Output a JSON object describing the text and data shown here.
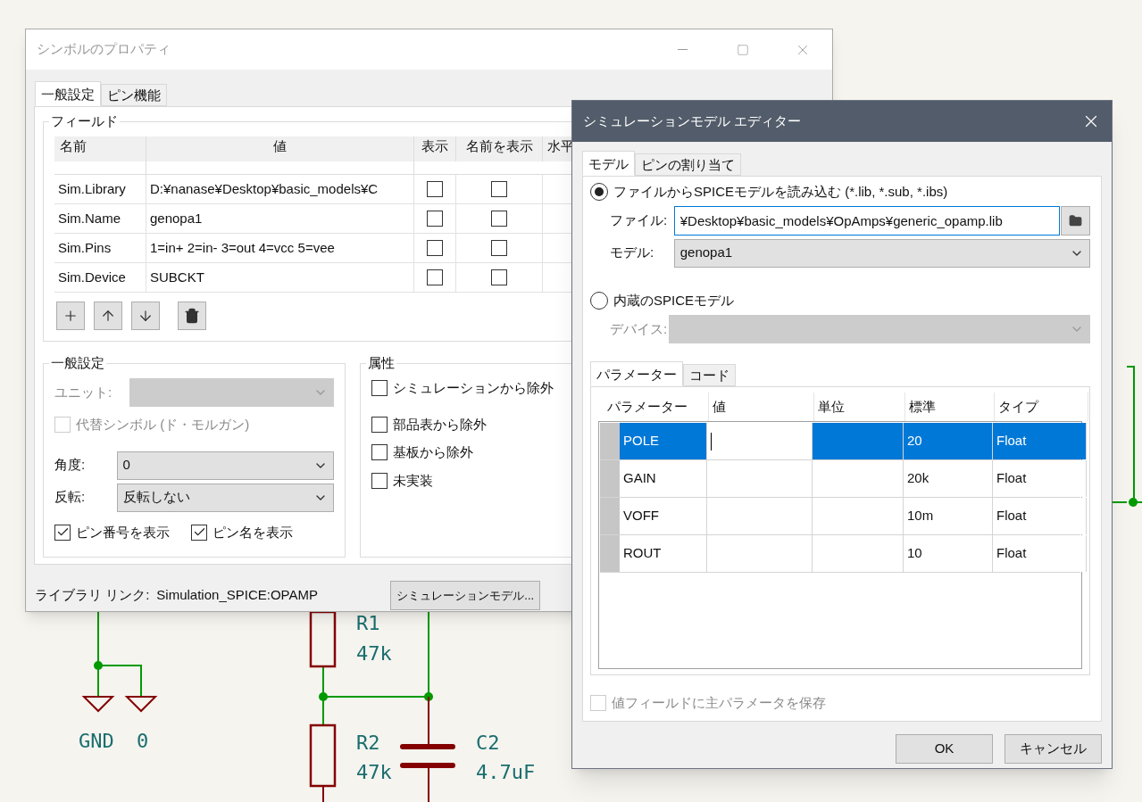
{
  "schematic": {
    "parts": [
      {
        "ref": "R1",
        "value": "47k"
      },
      {
        "ref": "R2",
        "value": "47k"
      },
      {
        "ref": "C2",
        "value": "4.7uF"
      }
    ],
    "power": [
      {
        "name": "GND"
      },
      {
        "name": "0"
      }
    ]
  },
  "symbol_dialog": {
    "title": "シンボルのプロパティ",
    "tabs": [
      {
        "label": "一般設定",
        "selected": true
      },
      {
        "label": "ピン機能",
        "selected": false
      }
    ],
    "fields": {
      "title": "フィールド",
      "columns": [
        "名前",
        "値",
        "表示",
        "名前を表示",
        "水平"
      ],
      "rows": [
        {
          "name": "Sim.Library",
          "value": "D:¥nanase¥Desktop¥basic_models¥C",
          "show": false,
          "show_name": false
        },
        {
          "name": "Sim.Name",
          "value": "genopa1",
          "show": false,
          "show_name": false
        },
        {
          "name": "Sim.Pins",
          "value": "1=in+ 2=in- 3=out 4=vcc 5=vee",
          "show": false,
          "show_name": false
        },
        {
          "name": "Sim.Device",
          "value": "SUBCKT",
          "show": false,
          "show_name": false
        }
      ]
    },
    "toolbar": [
      {
        "kind": "add"
      },
      {
        "kind": "up"
      },
      {
        "kind": "down"
      },
      {
        "kind": "delete"
      }
    ],
    "general": {
      "title": "一般設定",
      "unit": {
        "label": "ユニット:",
        "disabled": true
      },
      "alternate": {
        "label": "代替シンボル (ド・モルガン)",
        "checked": false,
        "disabled": true
      },
      "angle": {
        "label": "角度:",
        "value": "0"
      },
      "mirror": {
        "label": "反転:",
        "value": "反転しない"
      },
      "checks": [
        {
          "label": "ピン番号を表示",
          "checked": true
        },
        {
          "label": "ピン名を表示",
          "checked": true
        }
      ]
    },
    "attributes": {
      "title": "属性",
      "checks": [
        {
          "label": "シミュレーションから除外",
          "checked": false
        },
        {
          "label": "部品表から除外",
          "checked": false
        },
        {
          "label": "基板から除外",
          "checked": false
        },
        {
          "label": "未実装",
          "checked": false
        }
      ]
    },
    "library_link": {
      "label": "ライブラリ リンク:",
      "value": "Simulation_SPICE:OPAMP"
    },
    "sim_button": "シミュレーションモデル..."
  },
  "sim_dialog": {
    "title": "シミュレーションモデル エディター",
    "tabs": [
      {
        "label": "モデル",
        "selected": true
      },
      {
        "label": "ピンの割り当て",
        "selected": false
      }
    ],
    "from_file": {
      "label": "ファイルからSPICEモデルを読み込む (*.lib, *.sub, *.ibs)",
      "selected": true,
      "file_label": "ファイル:",
      "file": "¥Desktop¥basic_models¥OpAmps¥generic_opamp.lib",
      "model_label": "モデル:",
      "model": "genopa1"
    },
    "builtin": {
      "label": "内蔵のSPICEモデル",
      "selected": false,
      "device_label": "デバイス:",
      "disabled": true
    },
    "inner_tabs": [
      {
        "label": "パラメーター",
        "selected": true
      },
      {
        "label": "コード",
        "selected": false
      }
    ],
    "columns": [
      "パラメーター",
      "値",
      "単位",
      "標準",
      "タイプ"
    ],
    "params": [
      {
        "name": "POLE",
        "default": "20",
        "type": "Float",
        "selected": true,
        "editing": true
      },
      {
        "name": "GAIN",
        "default": "20k",
        "type": "Float",
        "selected": false,
        "editing": false
      },
      {
        "name": "VOFF",
        "default": "10m",
        "type": "Float",
        "selected": false,
        "editing": false
      },
      {
        "name": "ROUT",
        "default": "10",
        "type": "Float",
        "selected": false,
        "editing": false
      }
    ],
    "save_primary": {
      "label": "値フィールドに主パラメータを保存",
      "checked": false,
      "disabled": true
    },
    "buttons": [
      "OK",
      "キャンセル"
    ]
  }
}
